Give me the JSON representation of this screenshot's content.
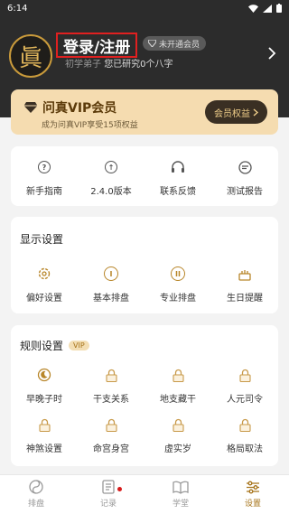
{
  "status_bar": {
    "time": "6:14"
  },
  "header": {
    "avatar_char": "眞",
    "login_label": "登录/注册",
    "level_badge": "未开通会员",
    "rank": "初学弟子",
    "progress_text": "您已研究0个八字"
  },
  "vip": {
    "title": "问真VIP会员",
    "subtitle": "成为问真VIP享受15项权益",
    "button_label": "会员权益"
  },
  "quick_links": [
    {
      "label": "新手指南",
      "icon": "question-icon"
    },
    {
      "label": "2.4.0版本",
      "icon": "upgrade-icon"
    },
    {
      "label": "联系反馈",
      "icon": "headset-icon"
    },
    {
      "label": "测试报告",
      "icon": "report-icon"
    }
  ],
  "display_settings": {
    "title": "显示设置",
    "items": [
      {
        "label": "偏好设置",
        "icon": "gear-icon"
      },
      {
        "label": "基本排盘",
        "icon": "roman-one-icon"
      },
      {
        "label": "专业排盘",
        "icon": "roman-two-icon"
      },
      {
        "label": "生日提醒",
        "icon": "cake-icon"
      }
    ]
  },
  "rule_settings": {
    "title": "规则设置",
    "vip_tag": "VIP",
    "items": [
      {
        "label": "早晚子时",
        "icon": "moon-icon"
      },
      {
        "label": "干支关系",
        "icon": "lock-icon"
      },
      {
        "label": "地支藏干",
        "icon": "lock-icon"
      },
      {
        "label": "人元司令",
        "icon": "lock-icon"
      },
      {
        "label": "神煞设置",
        "icon": "lock-icon"
      },
      {
        "label": "命宫身宫",
        "icon": "lock-icon"
      },
      {
        "label": "虚实岁",
        "icon": "lock-icon"
      },
      {
        "label": "格局取法",
        "icon": "lock-icon"
      }
    ]
  },
  "tabbar": [
    {
      "label": "排盘",
      "icon": "yinyang-icon"
    },
    {
      "label": "记录",
      "icon": "notes-icon"
    },
    {
      "label": "学堂",
      "icon": "book-icon"
    },
    {
      "label": "设置",
      "icon": "sliders-icon"
    }
  ],
  "colors": {
    "header_bg": "#2c2c2c",
    "gold": "#b8862a",
    "vip_bg": "#f5dcb0",
    "highlight": "#e02020",
    "badge_dot": "#d71a1a"
  }
}
